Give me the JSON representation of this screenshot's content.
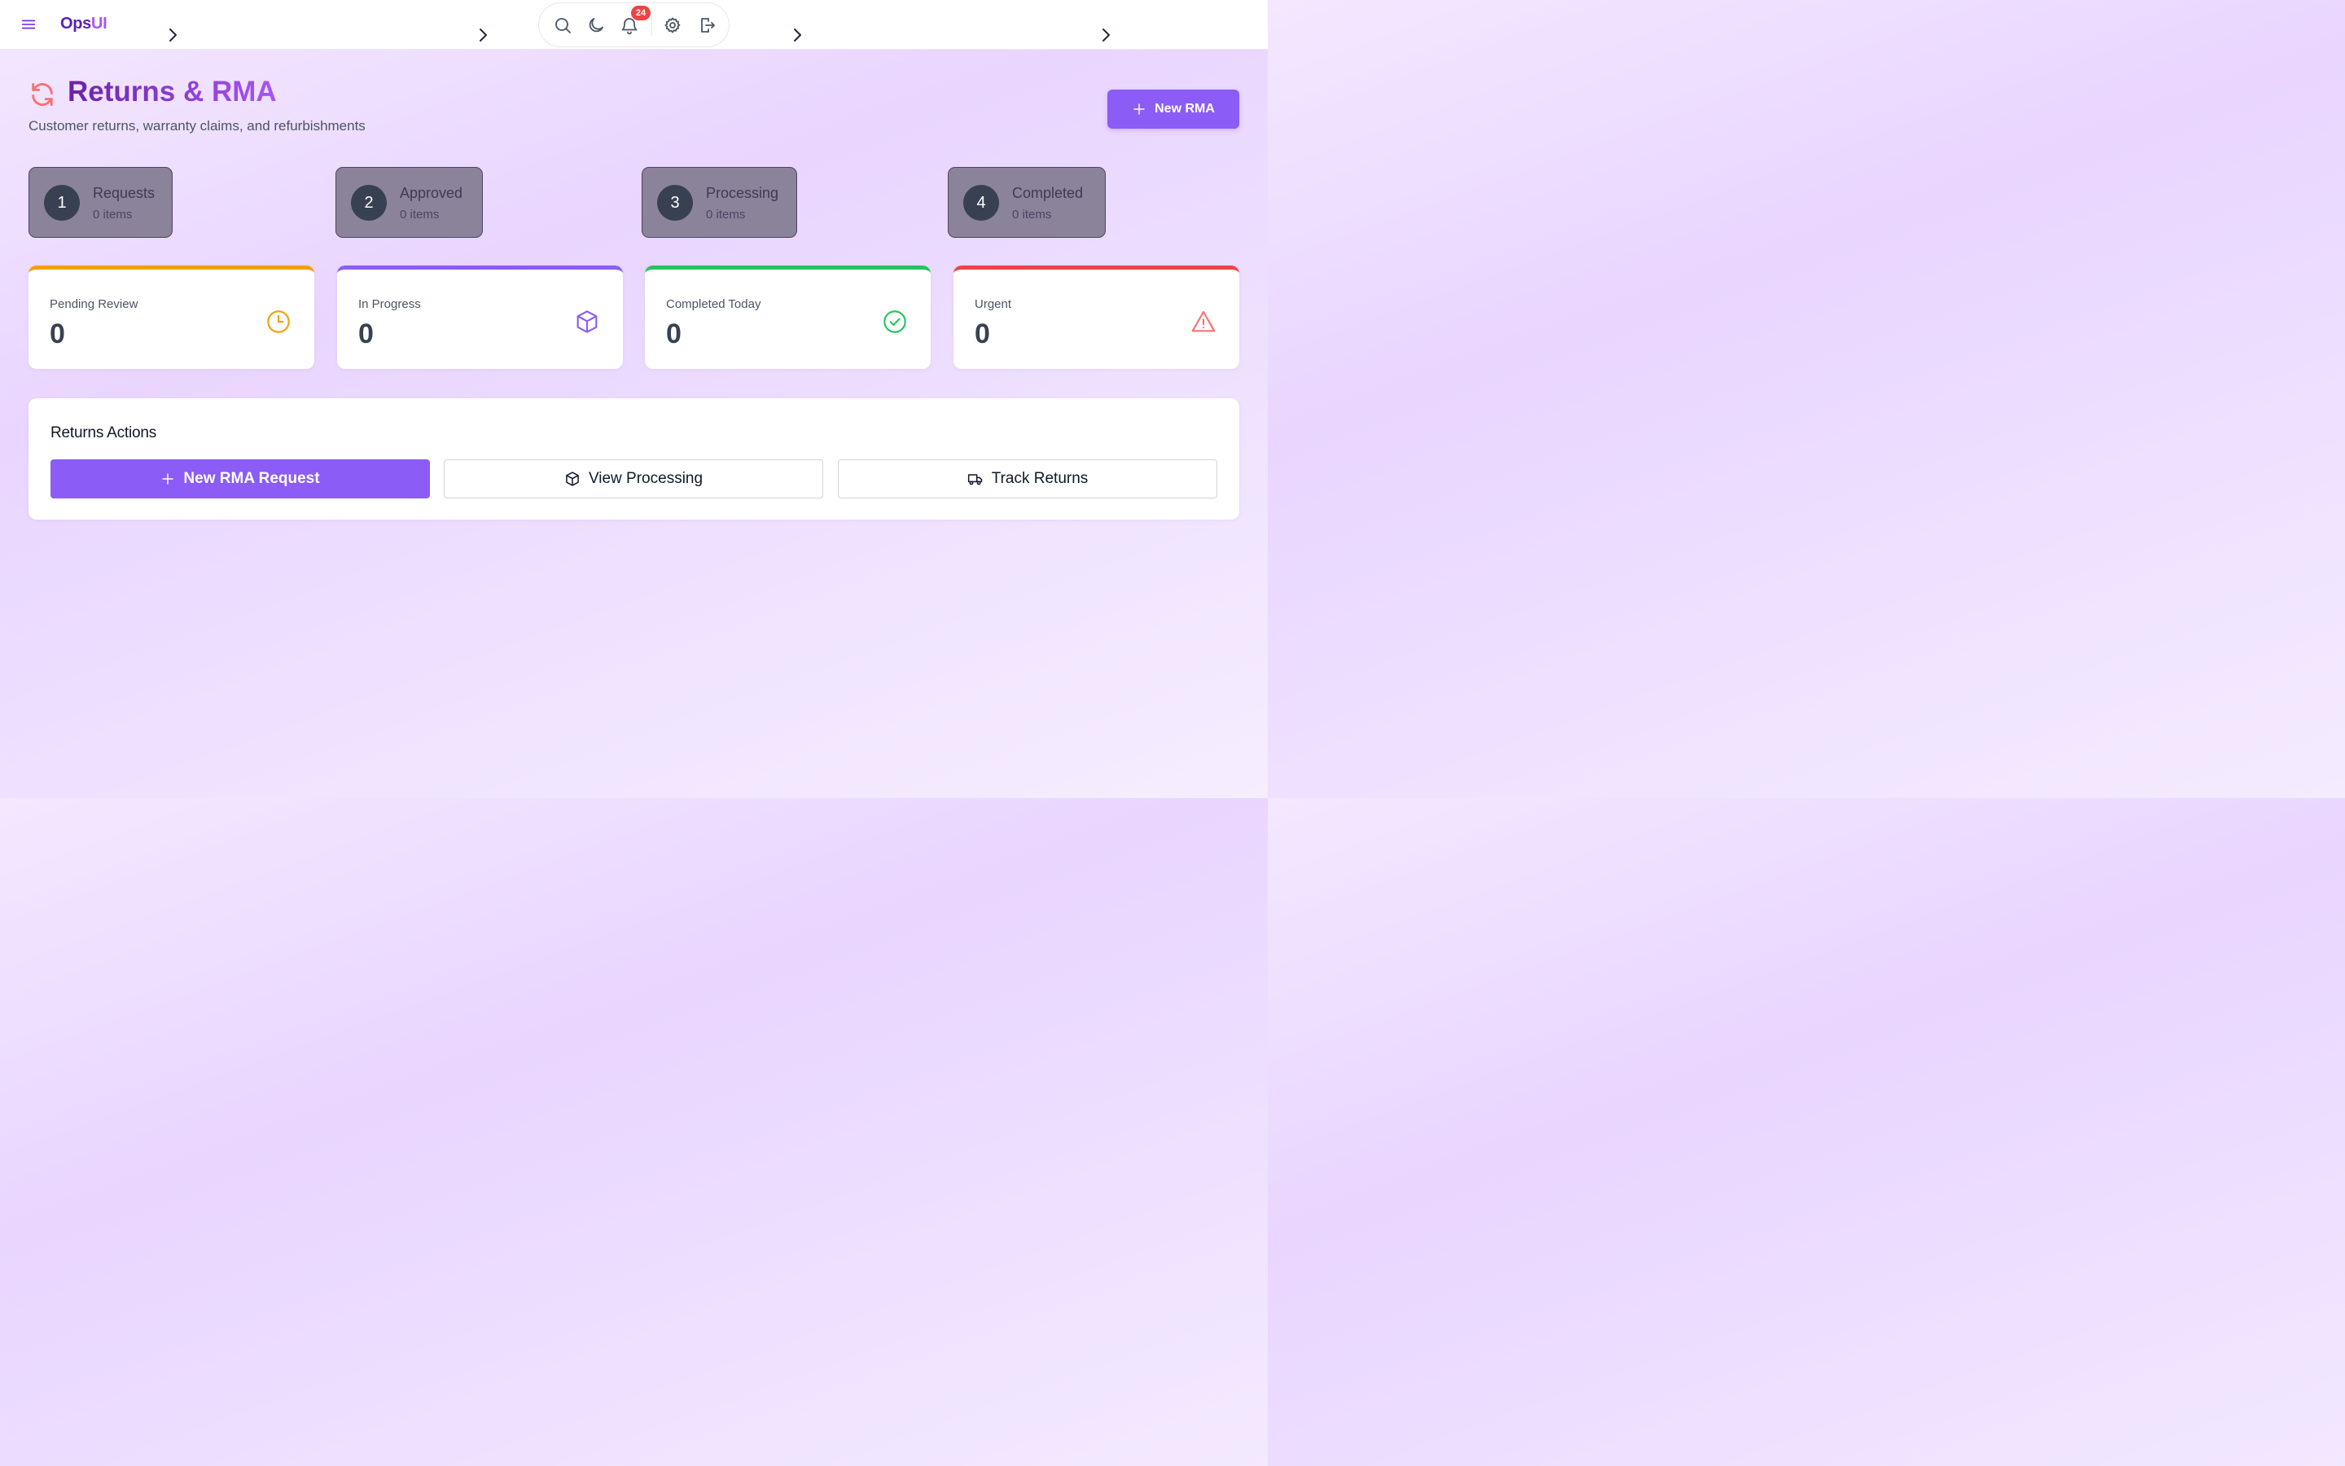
{
  "brand": {
    "part1": "Ops",
    "part2": "UI"
  },
  "toolbar": {
    "notification_count": "24"
  },
  "header": {
    "title": "Returns & RMA",
    "subtitle": "Customer returns, warranty claims, and refurbishments",
    "new_button": "New RMA"
  },
  "steps": [
    {
      "number": "1",
      "label": "Requests",
      "count": "0 items"
    },
    {
      "number": "2",
      "label": "Approved",
      "count": "0 items"
    },
    {
      "number": "3",
      "label": "Processing",
      "count": "0 items"
    },
    {
      "number": "4",
      "label": "Completed",
      "count": "0 items"
    }
  ],
  "stats": [
    {
      "label": "Pending Review",
      "value": "0",
      "icon": "clock-icon",
      "color": "#f59e0b"
    },
    {
      "label": "In Progress",
      "value": "0",
      "icon": "box-icon",
      "color": "#8b5cf6"
    },
    {
      "label": "Completed Today",
      "value": "0",
      "icon": "check-circle-icon",
      "color": "#22c55e"
    },
    {
      "label": "Urgent",
      "value": "0",
      "icon": "warning-icon",
      "color": "#ef4444"
    }
  ],
  "actions": {
    "title": "Returns Actions",
    "new_request": "New RMA Request",
    "view_processing": "View Processing",
    "track_returns": "Track Returns"
  },
  "colors": {
    "accent": "#8b5cf6",
    "brand_dark": "#5b21b6",
    "brand_light": "#a855f7",
    "refresh_icon": "#f87171"
  }
}
